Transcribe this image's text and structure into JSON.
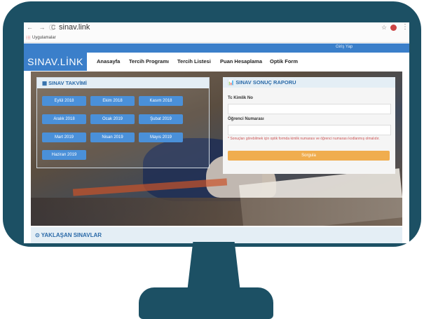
{
  "browser": {
    "nav_icons": "← → C",
    "info_icon": "ⓘ",
    "url": "sinav.link",
    "star_icon": "☆",
    "menu_icon": "⋮",
    "apps_icon": "⁝⁝⁝",
    "bookmarks_label": "Uygulamalar"
  },
  "site": {
    "login_label": "Giriş Yap",
    "logo": "SINAV.LİNK",
    "menu": [
      "Anasayfa",
      "Tercih Programı",
      "Tercih Listesi",
      "Puan Hesaplama",
      "Optik Form"
    ]
  },
  "calendar": {
    "title": "▦ SINAV TAKVİMİ",
    "months": [
      "Eylül 2018",
      "Ekim 2018",
      "Kasım 2018",
      "Aralık 2018",
      "Ocak 2019",
      "Şubat 2019",
      "Mart 2019",
      "Nisan 2019",
      "Mayıs 2019",
      "Haziran 2019"
    ]
  },
  "report": {
    "title": "📊 SINAV SONUÇ RAPORU",
    "tc_label": "Tc Kimlik No",
    "student_label": "Öğrenci Numarası",
    "note": "* Sonuçları görebilmek için optik formda kimlik numarası ve öğrenci numarası kodlanmış olmalıdır.",
    "submit": "Sorgula"
  },
  "upcoming": {
    "title": "⊙ YAKLAŞAN SINAVLAR"
  },
  "colors": {
    "monitor": "#1c5064",
    "brand_blue": "#3b7fca",
    "button_blue": "#4a90d9",
    "submit_orange": "#f0ad4e"
  }
}
